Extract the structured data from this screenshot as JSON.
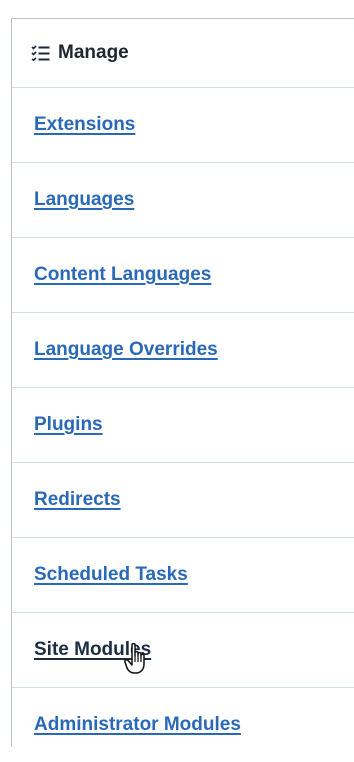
{
  "menu": {
    "title": "Manage",
    "items": [
      {
        "label": "Extensions"
      },
      {
        "label": "Languages"
      },
      {
        "label": "Content Languages"
      },
      {
        "label": "Language Overrides"
      },
      {
        "label": "Plugins"
      },
      {
        "label": "Redirects"
      },
      {
        "label": "Scheduled Tasks"
      },
      {
        "label": "Site Modules"
      },
      {
        "label": "Administrator Modules"
      }
    ]
  },
  "colors": {
    "link": "#2a69b8",
    "link_hover": "#1e2d44",
    "divider": "#d5dde5"
  },
  "icons": {
    "header": "list-check-icon",
    "cursor": "hand-pointer-icon"
  }
}
